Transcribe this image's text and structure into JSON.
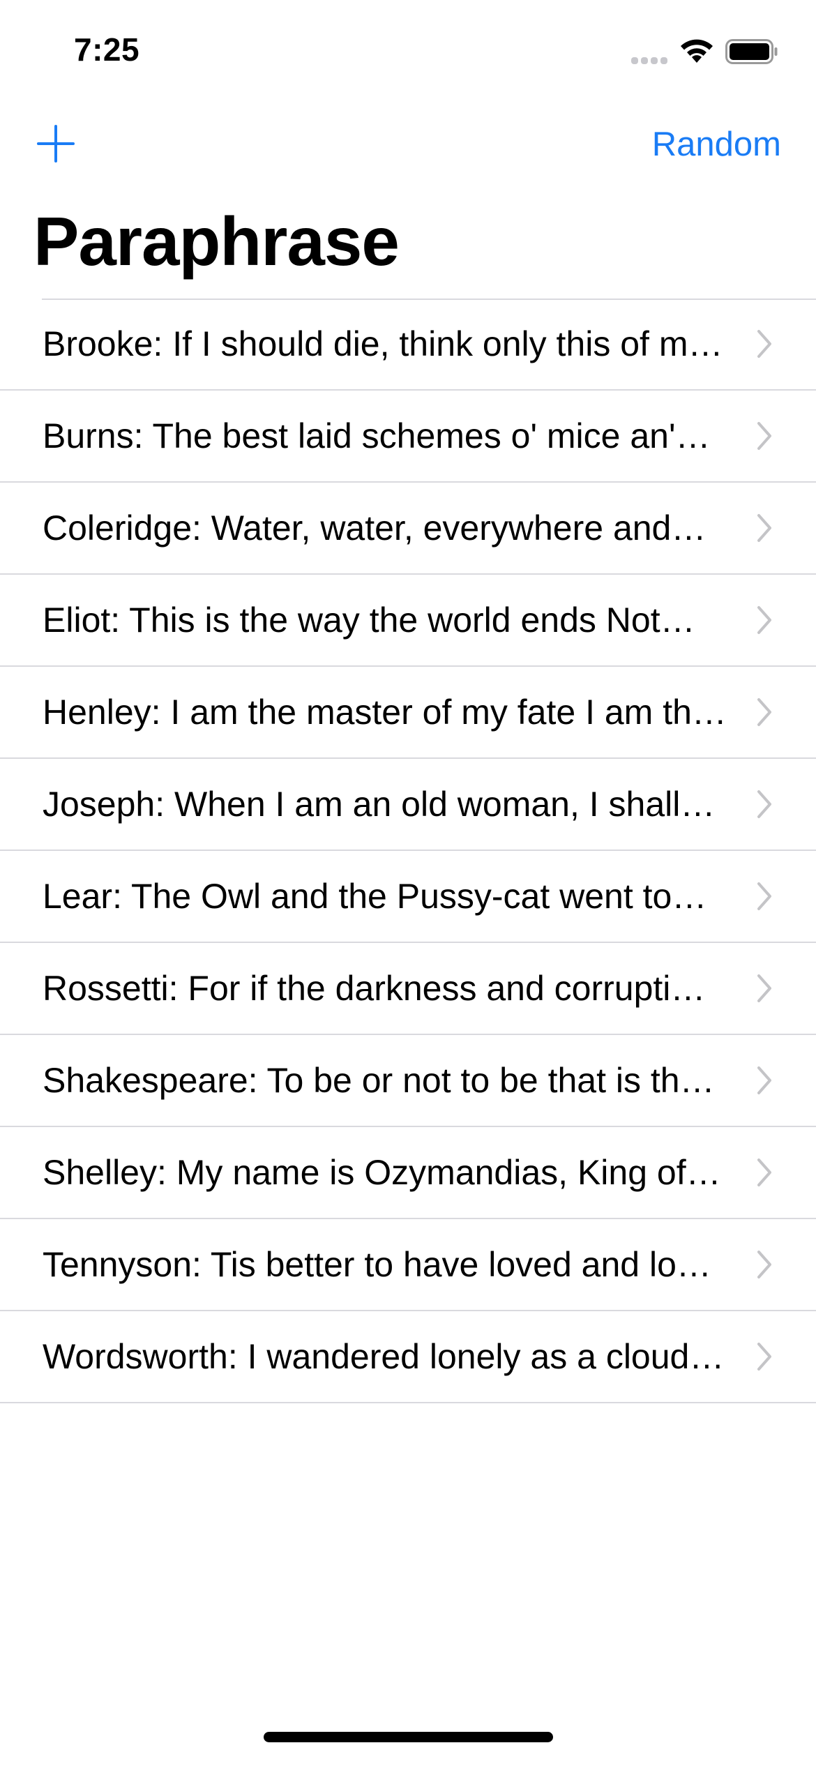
{
  "status_bar": {
    "time": "7:25"
  },
  "nav": {
    "add_icon": "plus-icon",
    "random_label": "Random",
    "title": "Paraphrase"
  },
  "list": {
    "items": [
      {
        "label": "Brooke: If I should die, think only this of m…"
      },
      {
        "label": "Burns: The best laid schemes o' mice an'…"
      },
      {
        "label": "Coleridge: Water, water, everywhere and…"
      },
      {
        "label": "Eliot: This is the way the world ends Not…"
      },
      {
        "label": "Henley: I am the master of my fate I am th…"
      },
      {
        "label": "Joseph: When I am an old woman, I shall…"
      },
      {
        "label": "Lear: The Owl and the Pussy-cat went to…"
      },
      {
        "label": "Rossetti: For if the darkness and corrupti…"
      },
      {
        "label": "Shakespeare: To be or not to be that is th…"
      },
      {
        "label": "Shelley: My name is Ozymandias, King of…"
      },
      {
        "label": "Tennyson: Tis better to have loved and lo…"
      },
      {
        "label": "Wordsworth: I wandered lonely as a cloud…"
      }
    ],
    "row_icon": "chevron-right-icon"
  },
  "colors": {
    "accent": "#1a7cf5",
    "separator": "#d9d9de",
    "chevron": "#c4c4c7",
    "text": "#000000",
    "background": "#ffffff"
  }
}
